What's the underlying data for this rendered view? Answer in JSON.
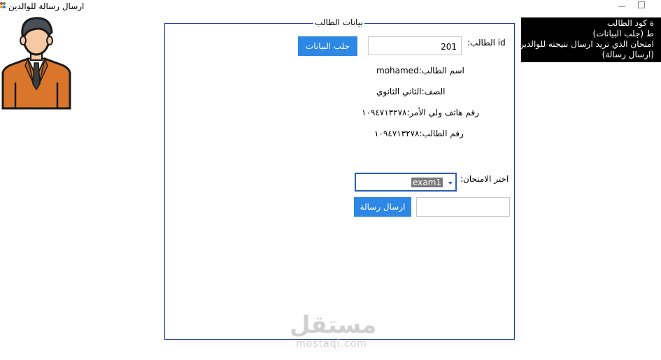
{
  "window": {
    "title": "ارسال رسالة للوالدين",
    "maximize_icon": "maximize-icon"
  },
  "student_group": {
    "title": "بيانات الطالب",
    "id_label": "id الطالب:",
    "id_value": "201",
    "fetch_button": "جلب البيانات",
    "name_label": "اسم الطالب:mohamed",
    "grade_label": "الصف:الثاني الثانوي",
    "parent_phone_label": "رقم هاتف ولي الأمر:١٠٩٤٧١٣٢٧٨",
    "student_phone_label": "رقم الطالب:١٠٩٤٧١٣٢٧٨",
    "exam_label": "اختر الامتحان:",
    "exam_selected": "exam1",
    "send_button": "ارسال رسالة",
    "message_value": ""
  },
  "instructions": {
    "line1": "ة كود الطالب",
    "line2": "ط (جلب البيانات)",
    "line3": "امتحان الذي تريد ارسال نتيجته للوالدين",
    "line4": "(ارسال رسالة)"
  },
  "watermark": {
    "arabic": "مستقل",
    "url": "mostaql.com"
  }
}
